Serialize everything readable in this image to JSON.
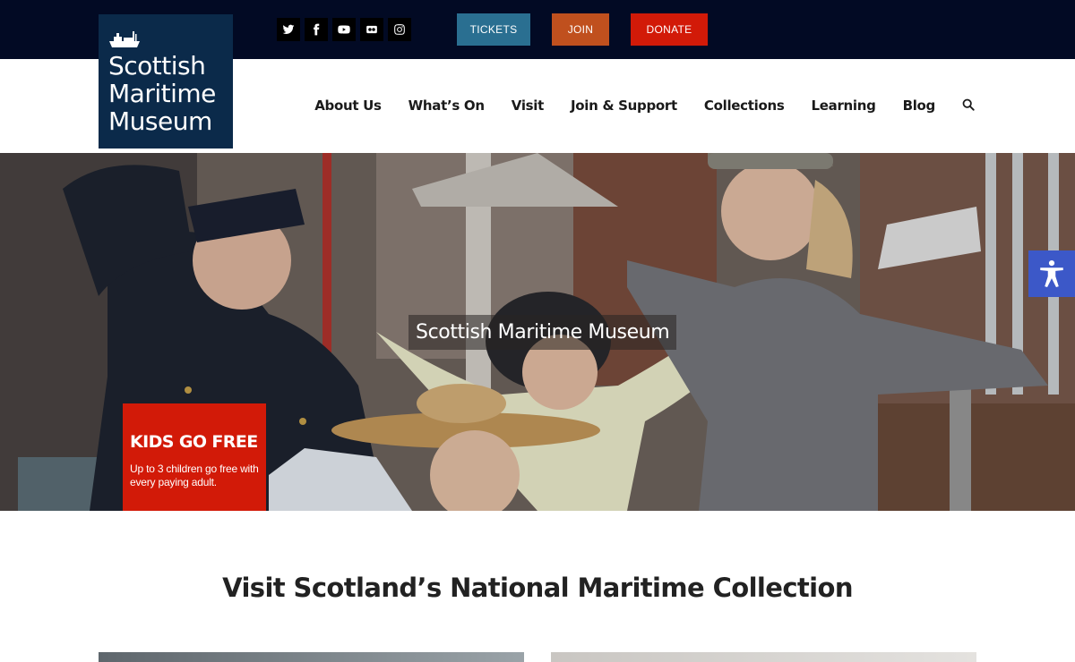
{
  "brand": {
    "logo_lines": [
      "Scottish",
      "Maritime",
      "Museum"
    ],
    "logo_bg": "#0b2a4a"
  },
  "topbar": {
    "social": [
      {
        "name": "twitter-icon"
      },
      {
        "name": "facebook-icon"
      },
      {
        "name": "youtube-icon"
      },
      {
        "name": "flickr-icon"
      },
      {
        "name": "instagram-icon"
      }
    ],
    "buttons": {
      "tickets": {
        "label": "TICKETS",
        "color": "#2a6f91"
      },
      "join": {
        "label": "JOIN",
        "color": "#c0501e"
      },
      "donate": {
        "label": "DONATE",
        "color": "#d21a08"
      }
    }
  },
  "nav": {
    "items": [
      "About Us",
      "What’s On",
      "Visit",
      "Join & Support",
      "Collections",
      "Learning",
      "Blog"
    ],
    "search_icon": "search-icon"
  },
  "hero": {
    "title": "Scottish Maritime Museum",
    "promo": {
      "heading": "KIDS GO FREE",
      "text": "Up to 3 children go free with every paying adult.",
      "color": "#d21a08"
    }
  },
  "accessibility": {
    "icon": "accessibility-icon",
    "color": "#3c58c8"
  },
  "main": {
    "section_title": "Visit Scotland’s National Maritime Collection"
  }
}
